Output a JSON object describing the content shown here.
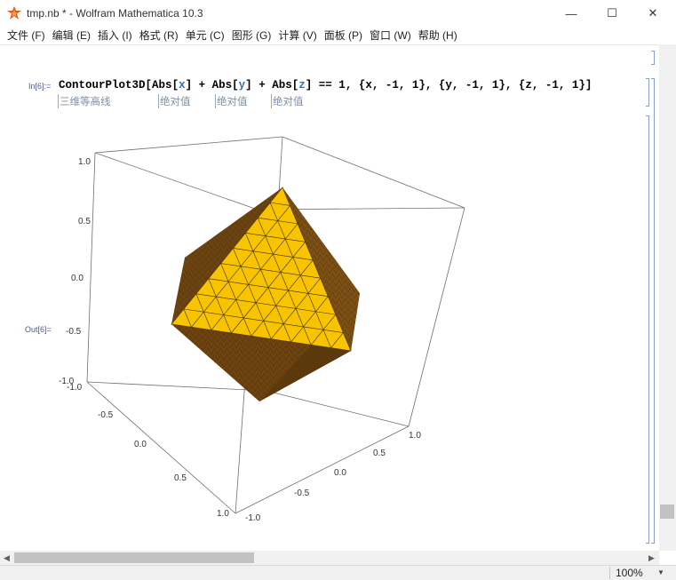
{
  "window": {
    "title": "tmp.nb * - Wolfram Mathematica 10.3",
    "minimize_glyph": "—",
    "maximize_glyph": "☐",
    "close_glyph": "✕"
  },
  "menu": [
    "文件 (F)",
    "编辑 (E)",
    "插入 (I)",
    "格式 (R)",
    "单元 (C)",
    "图形 (G)",
    "计算 (V)",
    "面板 (P)",
    "窗口 (W)",
    "帮助 (H)"
  ],
  "cell": {
    "in_label": "In[6]:=",
    "out_label": "Out[6]=",
    "code": {
      "func": "ContourPlot3D",
      "open": "[",
      "abs1": "Abs",
      "x": "x",
      "abs2": "Abs",
      "y": "y",
      "abs3": "Abs",
      "z": "z",
      "eq": "==",
      "one": "1",
      "r1": "{x, -1, 1}",
      "r2": "{y, -1, 1}",
      "r3": "{z, -1, 1}",
      "close": "]"
    },
    "hints": [
      "三维等高线",
      "绝对值",
      "绝对值",
      "绝对值"
    ]
  },
  "plot": {
    "face_color": "#f8c400",
    "shadow_color": "#7a4a12",
    "tick_labels_vertical": [
      "1.0",
      "0.5",
      "0.0",
      "-0.5",
      "-1.0"
    ],
    "tick_labels_left_axis": [
      "-1.0",
      "-0.5",
      "0.0",
      "0.5",
      "1.0"
    ],
    "tick_labels_right_axis": [
      "-1.0",
      "-0.5",
      "0.0",
      "0.5",
      "1.0"
    ]
  },
  "status": {
    "zoom": "100%"
  }
}
